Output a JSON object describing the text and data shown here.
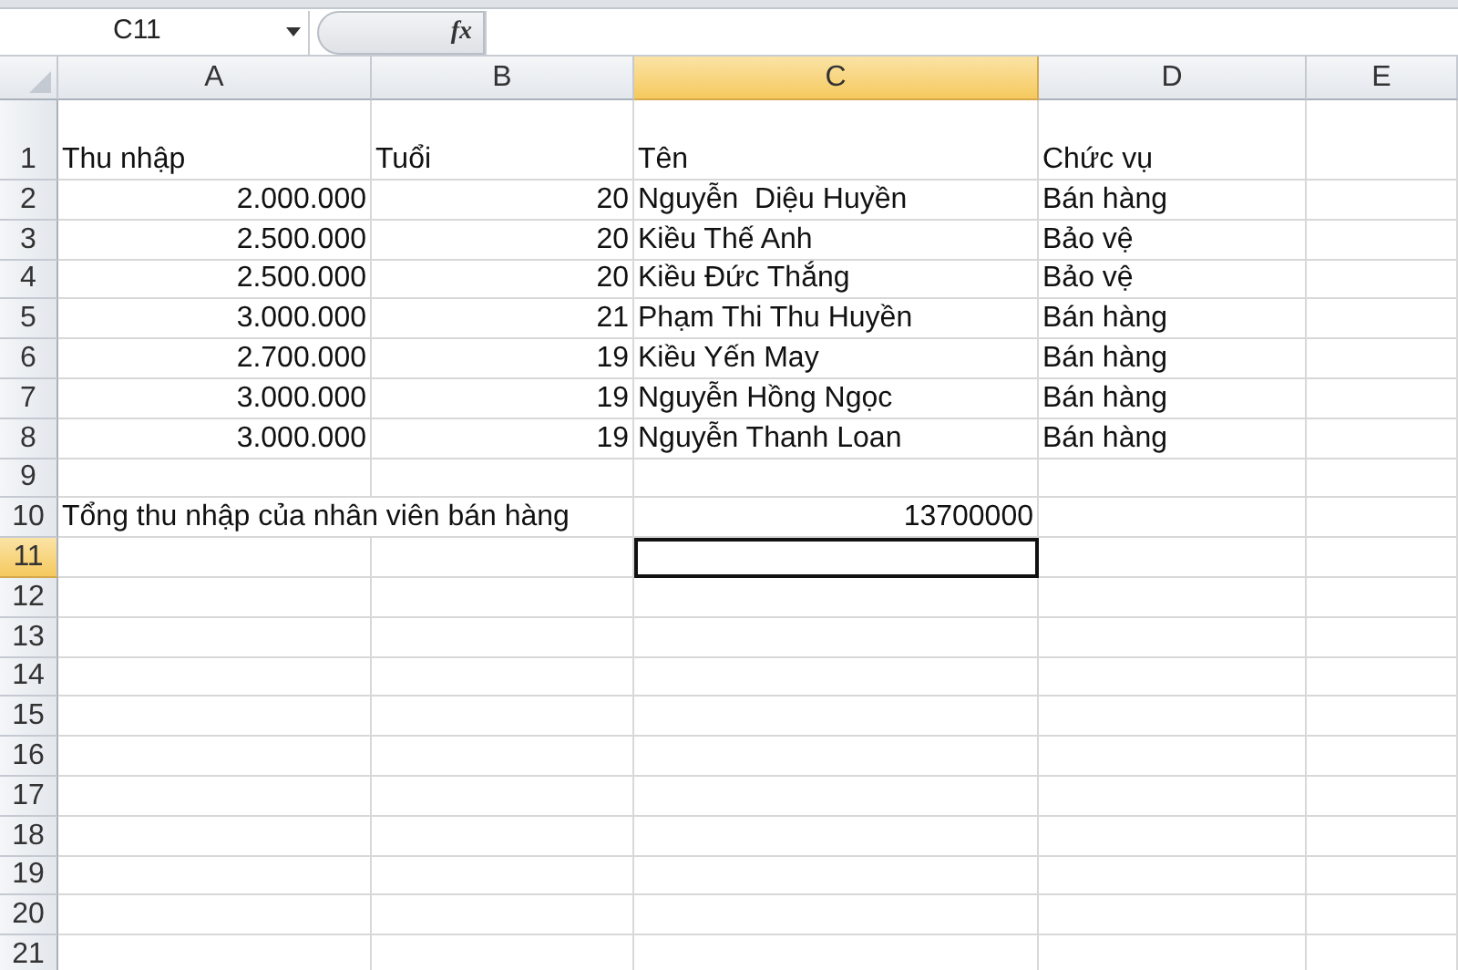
{
  "name_box": "C11",
  "formula_button": "fx",
  "columns": [
    {
      "label": "A",
      "selected": false
    },
    {
      "label": "B",
      "selected": false
    },
    {
      "label": "C",
      "selected": true
    },
    {
      "label": "D",
      "selected": false
    },
    {
      "label": "E",
      "selected": false
    }
  ],
  "rows": [
    {
      "number": "1",
      "selected": false,
      "kind": "tall",
      "cells": [
        {
          "text": "Thu nhập",
          "kind": "text"
        },
        {
          "text": "Tuổi",
          "kind": "text"
        },
        {
          "text": "Tên",
          "kind": "text"
        },
        {
          "text": "Chức vụ",
          "kind": "text"
        },
        null
      ]
    },
    {
      "number": "2",
      "selected": false,
      "cells": [
        {
          "text": "2.000.000",
          "kind": "number"
        },
        {
          "text": "20",
          "kind": "number"
        },
        {
          "text": "Nguyễn  Diệu Huyền",
          "kind": "text"
        },
        {
          "text": "Bán hàng",
          "kind": "text"
        },
        null
      ]
    },
    {
      "number": "3",
      "selected": false,
      "cells": [
        {
          "text": "2.500.000",
          "kind": "number"
        },
        {
          "text": "20",
          "kind": "number"
        },
        {
          "text": "Kiều Thế Anh",
          "kind": "text"
        },
        {
          "text": "Bảo vệ",
          "kind": "text"
        },
        null
      ]
    },
    {
      "number": "4",
      "selected": false,
      "cells": [
        {
          "text": "2.500.000",
          "kind": "number"
        },
        {
          "text": "20",
          "kind": "number"
        },
        {
          "text": "Kiều Đức Thắng",
          "kind": "text"
        },
        {
          "text": "Bảo vệ",
          "kind": "text"
        },
        null
      ]
    },
    {
      "number": "5",
      "selected": false,
      "cells": [
        {
          "text": "3.000.000",
          "kind": "number"
        },
        {
          "text": "21",
          "kind": "number"
        },
        {
          "text": "Phạm Thi Thu Huyền",
          "kind": "text"
        },
        {
          "text": "Bán hàng",
          "kind": "text"
        },
        null
      ]
    },
    {
      "number": "6",
      "selected": false,
      "cells": [
        {
          "text": "2.700.000",
          "kind": "number"
        },
        {
          "text": "19",
          "kind": "number"
        },
        {
          "text": "Kiều Yến May",
          "kind": "text"
        },
        {
          "text": "Bán hàng",
          "kind": "text"
        },
        null
      ]
    },
    {
      "number": "7",
      "selected": false,
      "cells": [
        {
          "text": "3.000.000",
          "kind": "number"
        },
        {
          "text": "19",
          "kind": "number"
        },
        {
          "text": "Nguyễn Hồng Ngọc",
          "kind": "text"
        },
        {
          "text": "Bán hàng",
          "kind": "text"
        },
        null
      ]
    },
    {
      "number": "8",
      "selected": false,
      "cells": [
        {
          "text": "3.000.000",
          "kind": "number"
        },
        {
          "text": "19",
          "kind": "number"
        },
        {
          "text": "Nguyễn Thanh Loan",
          "kind": "text"
        },
        {
          "text": "Bán hàng",
          "kind": "text"
        },
        null
      ]
    },
    {
      "number": "9",
      "selected": false
    },
    {
      "number": "10",
      "selected": false,
      "cells": [
        {
          "text": "Tổng thu nhập của nhân viên bán hàng",
          "kind": "text"
        },
        null,
        {
          "text": "13700000",
          "kind": "number"
        },
        null,
        null
      ]
    },
    {
      "number": "11",
      "selected": true
    },
    {
      "number": "12",
      "selected": false
    },
    {
      "number": "13",
      "selected": false
    },
    {
      "number": "14",
      "selected": false
    },
    {
      "number": "15",
      "selected": false
    },
    {
      "number": "16",
      "selected": false
    },
    {
      "number": "17",
      "selected": false
    },
    {
      "number": "18",
      "selected": false
    },
    {
      "number": "19",
      "selected": false
    },
    {
      "number": "20",
      "selected": false
    },
    {
      "number": "21",
      "selected": false
    }
  ]
}
